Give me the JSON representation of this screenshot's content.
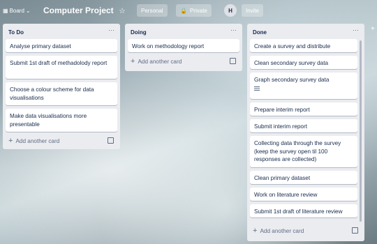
{
  "header": {
    "board_btn": "Board",
    "title": "Computer Project",
    "visibility_team": "Personal",
    "visibility_private": "Private",
    "avatar_initial": "H",
    "invite": "Invite"
  },
  "lists": [
    {
      "title": "To Do",
      "cards": [
        "Analyse primary dataset",
        "Submit 1st draft of methadolody report",
        "Choose a colour scheme for data visualisations",
        "Make data visualisations more presentable"
      ],
      "add": "Add another card"
    },
    {
      "title": "Doing",
      "cards": [
        "Work on methodology report"
      ],
      "add": "Add another card"
    },
    {
      "title": "Done",
      "cards": [
        "Create a survey and distribute",
        "Clean secondary survey data",
        "Graph secondary survey data",
        "Prepare interim report",
        "Submit interim report",
        "Collecting data through the survey (keep the survey open til 100 responses are collected)",
        "Clean primary dataset",
        "Work on literature review",
        "Submit 1st draft of literature review"
      ],
      "add": "Add another card"
    }
  ],
  "icons": {
    "star": "star-icon",
    "menu": "ellipsis-icon",
    "template": "template-icon",
    "lock": "lock-icon"
  }
}
